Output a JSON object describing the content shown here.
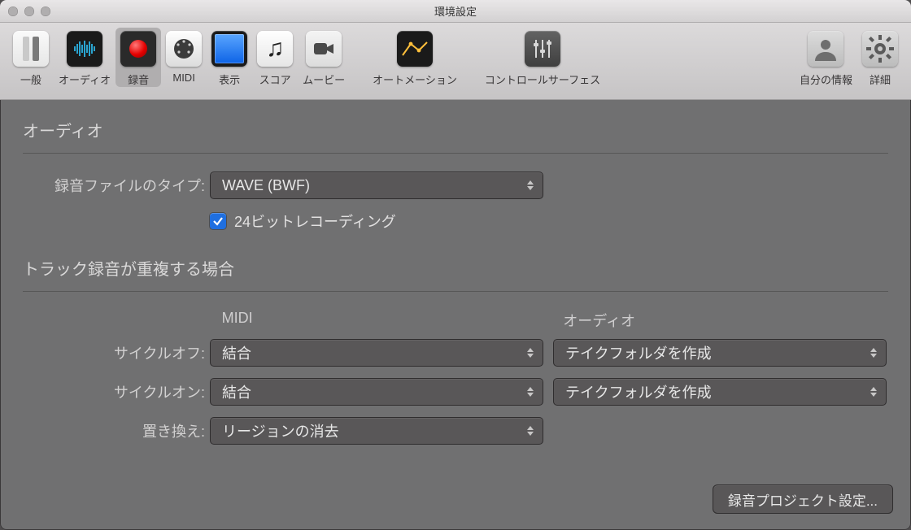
{
  "window": {
    "title": "環境設定"
  },
  "toolbar": {
    "items": [
      {
        "id": "general",
        "label": "一般"
      },
      {
        "id": "audio",
        "label": "オーディオ"
      },
      {
        "id": "record",
        "label": "録音",
        "selected": true
      },
      {
        "id": "midi",
        "label": "MIDI"
      },
      {
        "id": "display",
        "label": "表示"
      },
      {
        "id": "score",
        "label": "スコア"
      },
      {
        "id": "movie",
        "label": "ムービー"
      },
      {
        "id": "automation",
        "label": "オートメーション"
      },
      {
        "id": "cs",
        "label": "コントロールサーフェス"
      },
      {
        "id": "user",
        "label": "自分の情報"
      },
      {
        "id": "advanced",
        "label": "詳細"
      }
    ]
  },
  "sections": {
    "audio": {
      "title": "オーディオ",
      "file_type_label": "録音ファイルのタイプ:",
      "file_type_value": "WAVE (BWF)",
      "bit24_label": "24ビットレコーディング",
      "bit24_checked": true
    },
    "overlap": {
      "title": "トラック録音が重複する場合",
      "col_midi": "MIDI",
      "col_audio": "オーディオ",
      "cycle_off_label": "サイクルオフ:",
      "cycle_off_midi": "結合",
      "cycle_off_audio": "テイクフォルダを作成",
      "cycle_on_label": "サイクルオン:",
      "cycle_on_midi": "結合",
      "cycle_on_audio": "テイクフォルダを作成",
      "replace_label": "置き換え:",
      "replace_value": "リージョンの消去"
    }
  },
  "footer": {
    "project_settings_button": "録音プロジェクト設定..."
  }
}
